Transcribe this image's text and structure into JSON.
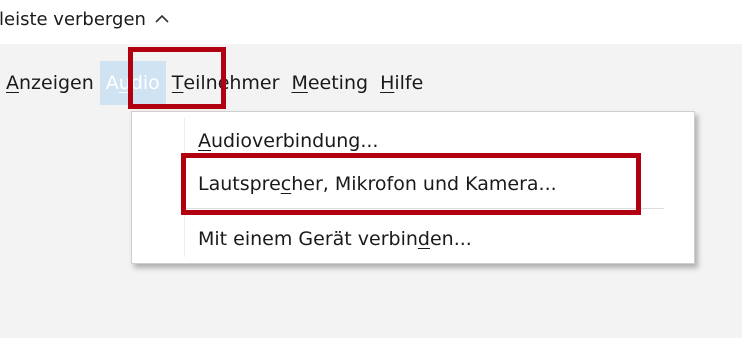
{
  "toolbar_toggle": {
    "label": "ileiste verbergen"
  },
  "menubar": {
    "items": [
      {
        "pre": "",
        "key": "A",
        "post": "nzeigen"
      },
      {
        "pre": "A",
        "key": "u",
        "post": "dio"
      },
      {
        "pre": "",
        "key": "T",
        "post": "eilnehmer"
      },
      {
        "pre": "",
        "key": "M",
        "post": "eeting"
      },
      {
        "pre": "",
        "key": "H",
        "post": "ilfe"
      }
    ]
  },
  "audio_menu": {
    "items": [
      {
        "pre": "",
        "key": "A",
        "post": "udioverbindung..."
      },
      {
        "pre": "Lautspre",
        "key": "c",
        "post": "her, Mikrofon und Kamera..."
      },
      {
        "pre": "Mit einem Gerät verbin",
        "key": "d",
        "post": "en..."
      }
    ]
  },
  "colors": {
    "highlight_border": "#b1000f",
    "active_menu_bg": "#cfe3f2",
    "window_bg": "#f3f3f3"
  }
}
